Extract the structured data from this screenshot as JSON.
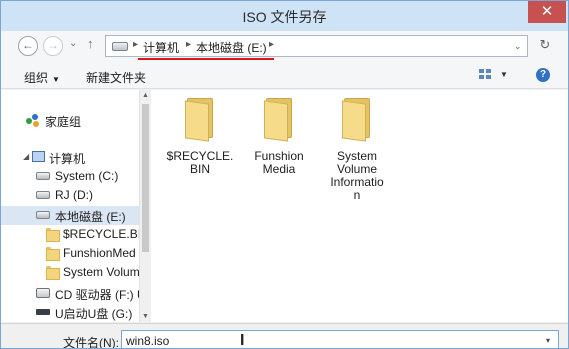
{
  "window": {
    "title": "ISO 文件另存",
    "close_label": "✕"
  },
  "nav": {
    "back_label": "←",
    "forward_label": "→",
    "recent_label": "⌄",
    "up_label": "↑",
    "breadcrumb": [
      "计算机",
      "本地磁盘 (E:)"
    ],
    "sep": "▸",
    "dropdown_label": "⌄",
    "refresh_label": "↻"
  },
  "toolbar": {
    "organize_label": "组织",
    "new_folder_label": "新建文件夹",
    "help_label": "?"
  },
  "sidebar": {
    "homegroup": "家庭组",
    "computer": "计算机",
    "items": [
      {
        "label": "System (C:)",
        "icon": "drive-icon"
      },
      {
        "label": "RJ (D:)",
        "icon": "drive-icon"
      },
      {
        "label": "本地磁盘 (E:)",
        "icon": "drive-icon",
        "selected": true
      },
      {
        "label": "$RECYCLE.BIN",
        "icon": "folder-icon"
      },
      {
        "label": "FunshionMed",
        "icon": "folder-icon"
      },
      {
        "label": "System Volum",
        "icon": "folder-icon"
      },
      {
        "label": "CD 驱动器 (F:) U",
        "icon": "dvd-icon"
      },
      {
        "label": "U启动U盘 (G:)",
        "icon": "usb-icon"
      }
    ]
  },
  "content": {
    "folders": [
      {
        "line1": "$RECYCLE.",
        "line2": "BIN",
        "line3": "",
        "line4": ""
      },
      {
        "line1": "Funshion",
        "line2": "Media",
        "line3": "",
        "line4": ""
      },
      {
        "line1": "System",
        "line2": "Volume",
        "line3": "Informatio",
        "line4": "n"
      }
    ]
  },
  "filename": {
    "label": "文件名(N):",
    "value": "win8.iso",
    "caret": "▾"
  },
  "colors": {
    "accent_underline": "#d8181e",
    "close_button": "#c75050",
    "selection": "#dbe6f4"
  }
}
